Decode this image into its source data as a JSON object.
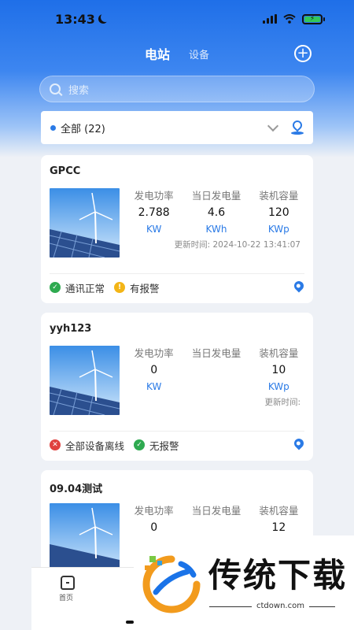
{
  "status_bar": {
    "time": "13:43"
  },
  "nav": {
    "active_tab": "电站",
    "other_tab": "设备"
  },
  "search": {
    "placeholder": "搜索"
  },
  "filter": {
    "label": "全部 (22)"
  },
  "stations": [
    {
      "name": "GPCC",
      "stats": [
        {
          "label": "发电功率",
          "value": "2.788",
          "unit": "KW"
        },
        {
          "label": "当日发电量",
          "value": "4.6",
          "unit": "KWh"
        },
        {
          "label": "装机容量",
          "value": "120",
          "unit": "KWp"
        }
      ],
      "update_time": "更新时间: 2024-10-22 13:41:07",
      "comm_status": "通讯正常",
      "alarm_status": "有报警"
    },
    {
      "name": "yyh123",
      "stats": [
        {
          "label": "发电功率",
          "value": "0",
          "unit": "KW"
        },
        {
          "label": "当日发电量",
          "value": "",
          "unit": ""
        },
        {
          "label": "装机容量",
          "value": "10",
          "unit": "KWp"
        }
      ],
      "update_time": "更新时间:",
      "comm_status": "全部设备离线",
      "alarm_status": "无报警"
    },
    {
      "name": "09.04测试",
      "stats": [
        {
          "label": "发电功率",
          "value": "0",
          "unit": ""
        },
        {
          "label": "当日发电量",
          "value": "",
          "unit": ""
        },
        {
          "label": "装机容量",
          "value": "12",
          "unit": ""
        }
      ]
    }
  ],
  "tabbar": {
    "home_label": "首页"
  },
  "watermark": {
    "title": "传统下载",
    "url": "ctdown.com"
  },
  "colors": {
    "primary": "#2a7ae6",
    "ok": "#2eaa50",
    "warn": "#f3b517",
    "error": "#e0413f"
  }
}
